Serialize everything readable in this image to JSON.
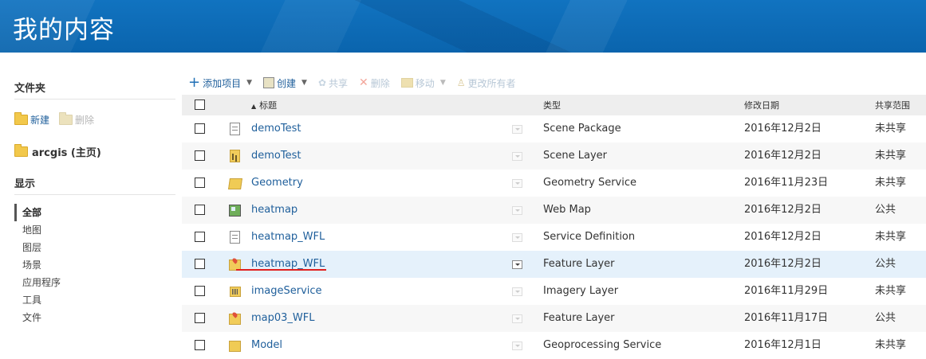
{
  "banner": {
    "title": "我的内容"
  },
  "sidebar": {
    "folders_heading": "文件夹",
    "new_label": "新建",
    "delete_label": "删除",
    "current_folder": "arcgis (主页)",
    "show_heading": "显示",
    "filters": [
      "全部",
      "地图",
      "图层",
      "场景",
      "应用程序",
      "工具",
      "文件"
    ]
  },
  "toolbar": {
    "add_item": "添加项目",
    "create": "创建",
    "share": "共享",
    "delete": "删除",
    "move": "移动",
    "change_owner": "更改所有者"
  },
  "table": {
    "headers": {
      "title": "标题",
      "type": "类型",
      "modified": "修改日期",
      "sharing": "共享范围"
    },
    "rows": [
      {
        "title": "demoTest",
        "type": "Scene Package",
        "modified": "2016年12月2日",
        "sharing": "未共享",
        "icon": "document-icon"
      },
      {
        "title": "demoTest",
        "type": "Scene Layer",
        "modified": "2016年12月2日",
        "sharing": "未共享",
        "icon": "scene-layer-icon"
      },
      {
        "title": "Geometry",
        "type": "Geometry Service",
        "modified": "2016年11月23日",
        "sharing": "未共享",
        "icon": "geometry-service-icon"
      },
      {
        "title": "heatmap",
        "type": "Web Map",
        "modified": "2016年12月2日",
        "sharing": "公共",
        "icon": "web-map-icon"
      },
      {
        "title": "heatmap_WFL",
        "type": "Service Definition",
        "modified": "2016年12月2日",
        "sharing": "未共享",
        "icon": "document-icon"
      },
      {
        "title": "heatmap_WFL",
        "type": "Feature Layer",
        "modified": "2016年12月2日",
        "sharing": "公共",
        "icon": "feature-layer-icon"
      },
      {
        "title": "imageService",
        "type": "Imagery Layer",
        "modified": "2016年11月29日",
        "sharing": "未共享",
        "icon": "imagery-layer-icon"
      },
      {
        "title": "map03_WFL",
        "type": "Feature Layer",
        "modified": "2016年11月17日",
        "sharing": "公共",
        "icon": "feature-layer-icon"
      },
      {
        "title": "Model",
        "type": "Geoprocessing Service",
        "modified": "2016年12月1日",
        "sharing": "未共享",
        "icon": "geoprocessing-icon"
      }
    ]
  }
}
